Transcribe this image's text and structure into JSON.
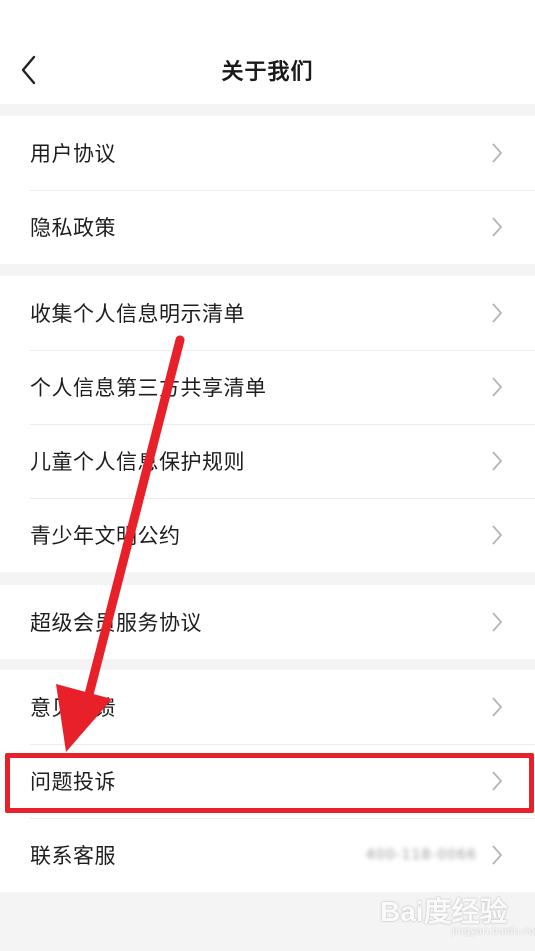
{
  "header": {
    "title": "关于我们"
  },
  "groups": [
    {
      "items": [
        {
          "label": "用户协议"
        },
        {
          "label": "隐私政策"
        }
      ]
    },
    {
      "items": [
        {
          "label": "收集个人信息明示清单"
        },
        {
          "label": "个人信息第三方共享清单"
        },
        {
          "label": "儿童个人信息保护规则"
        },
        {
          "label": "青少年文明公约"
        }
      ]
    },
    {
      "items": [
        {
          "label": "超级会员服务协议"
        }
      ]
    },
    {
      "items": [
        {
          "label": "意见反馈"
        },
        {
          "label": "问题投诉"
        },
        {
          "label": "联系客服",
          "value": "400-118-0066"
        }
      ]
    }
  ],
  "icons": {
    "back": "chevron-left-icon",
    "row": "chevron-right-icon"
  },
  "colors": {
    "annotation": "#e8202a",
    "background": "#f4f4f4"
  },
  "watermark": {
    "brand": "Bai度经验",
    "url": "jingyan.baidu.com"
  }
}
